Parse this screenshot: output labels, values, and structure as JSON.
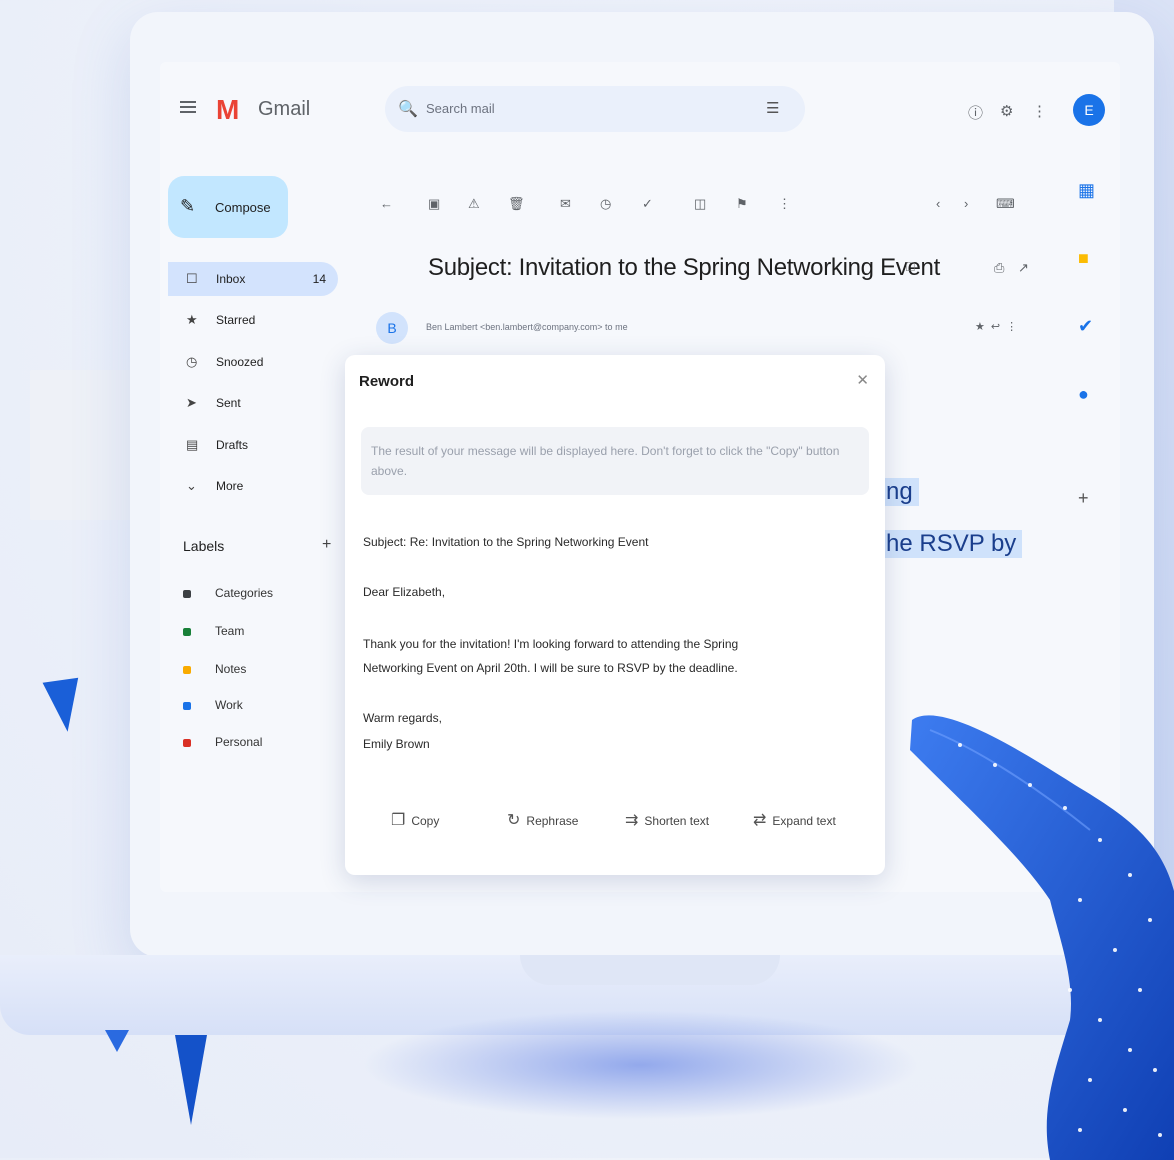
{
  "app": {
    "name": "Gmail",
    "logo_letter": "M",
    "avatar_initial": "E"
  },
  "search": {
    "placeholder": "Search mail"
  },
  "compose_label": "Compose",
  "nav": [
    {
      "label": "Inbox",
      "count": "14",
      "icon": "inbox-icon",
      "active": true
    },
    {
      "label": "Starred",
      "icon": "star-icon"
    },
    {
      "label": "Snoozed",
      "icon": "clock-icon"
    },
    {
      "label": "Sent",
      "icon": "send-icon"
    },
    {
      "label": "Drafts",
      "icon": "draft-icon"
    },
    {
      "label": "More",
      "icon": "chevron-down-icon"
    }
  ],
  "labels": {
    "title": "Labels",
    "items": [
      {
        "name": "Categories",
        "color": "#3c4043"
      },
      {
        "name": "Team",
        "color": "#188038"
      },
      {
        "name": "Notes",
        "color": "#f9ab00"
      },
      {
        "name": "Work",
        "color": "#1a73e8"
      },
      {
        "name": "Personal",
        "color": "#d93025"
      }
    ]
  },
  "email": {
    "subject": "Subject: Invitation to the Spring Networking Event",
    "sender_avatar": "B",
    "sender_line": "Ben Lambert  <ben.lambert@company.com>  to me",
    "highlighted": [
      "ng",
      "he RSVP by"
    ]
  },
  "reword": {
    "title": "Reword",
    "prompt": "The result of your message will be displayed here. Don't forget to click the \"Copy\" button above.",
    "body": [
      "Subject: Re: Invitation to the Spring Networking Event",
      "Dear Elizabeth,",
      "Thank you for the invitation! I'm looking forward to attending the Spring",
      "Networking Event on April 20th. I will be sure to RSVP by the deadline.",
      "Warm regards,",
      "Emily Brown"
    ],
    "actions": {
      "copy": "Copy",
      "rephrase": "Rephrase",
      "shorten": "Shorten text",
      "expand": "Expand text"
    }
  }
}
